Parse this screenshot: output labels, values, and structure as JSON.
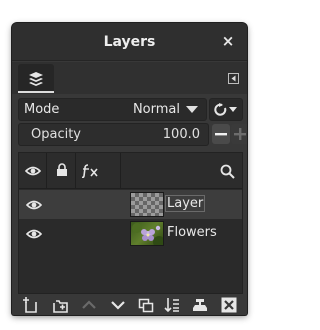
{
  "window": {
    "title": "Layers",
    "close_label": "×"
  },
  "tabs": {
    "active_icon": "layers-stack-icon",
    "menu_icon": "tab-menu-icon"
  },
  "mode": {
    "label": "Mode",
    "value": "Normal",
    "composite_icon": "composite-mode-icon"
  },
  "opacity": {
    "label": "Opacity",
    "value": "100.0"
  },
  "columns": [
    {
      "icon": "eye-icon"
    },
    {
      "icon": "lock-icon"
    },
    {
      "icon": "fx-icon"
    },
    {
      "icon": "search-icon"
    }
  ],
  "layers": [
    {
      "name": "Layer",
      "visible": true,
      "selected": true,
      "thumbnail": "transparent-checkerboard"
    },
    {
      "name": "Flowers",
      "visible": true,
      "selected": false,
      "thumbnail": "flowers-photo"
    }
  ],
  "bottom_toolbar": [
    "new-layer-icon",
    "new-layer-group-icon",
    "raise-layer-icon",
    "lower-layer-icon",
    "duplicate-layer-icon",
    "merge-down-icon",
    "anchor-layer-icon",
    "delete-layer-icon"
  ],
  "colors": {
    "panel_bg": "#383838",
    "titlebar_bg": "#2f2f2f",
    "list_bg": "#2a2a2a",
    "selected_row": "#3d3d3d"
  }
}
